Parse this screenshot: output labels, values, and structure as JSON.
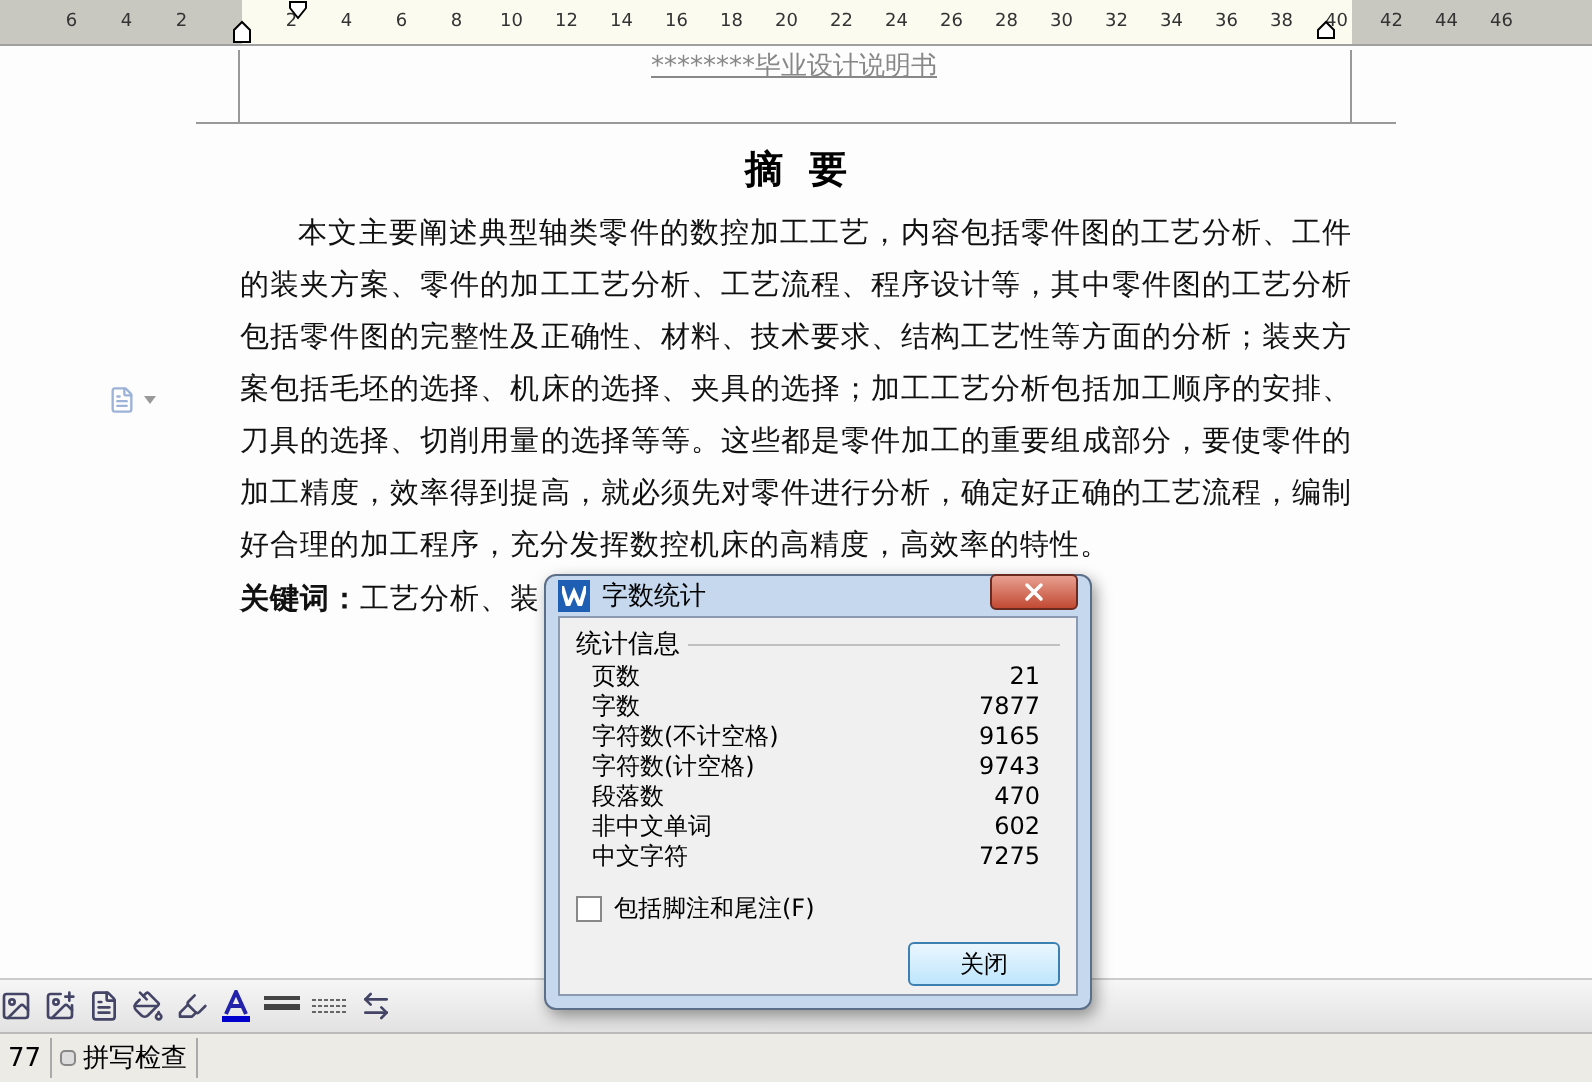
{
  "ruler": {
    "labels": [
      "6",
      "4",
      "2",
      "2",
      "4",
      "6",
      "8",
      "10",
      "12",
      "14",
      "16",
      "18",
      "20",
      "22",
      "24",
      "26",
      "28",
      "30",
      "32",
      "34",
      "36",
      "38",
      "40",
      "42",
      "44",
      "46"
    ]
  },
  "document": {
    "header": "********毕业设计说明书",
    "title": "摘  要",
    "body": "本文主要阐述典型轴类零件的数控加工工艺，内容包括零件图的工艺分析、工件的装夹方案、零件的加工工艺分析、工艺流程、程序设计等，其中零件图的工艺分析包括零件图的完整性及正确性、材料、技术要求、结构工艺性等方面的分析；装夹方案包括毛坯的选择、机床的选择、夹具的选择；加工工艺分析包括加工顺序的安排、刀具的选择、切削用量的选择等等。这些都是零件加工的重要组成部分，要使零件的加工精度，效率得到提高，就必须先对零件进行分析，确定好正确的工艺流程，编制好合理的加工程序，充分发挥数控机床的高精度，高效率的特性。",
    "keywords_label": "关键词：",
    "keywords": "工艺分析、装"
  },
  "dialog": {
    "title": "字数统计",
    "group": "统计信息",
    "rows": [
      {
        "label": "页数",
        "value": "21"
      },
      {
        "label": "字数",
        "value": "7877"
      },
      {
        "label": "字符数(不计空格)",
        "value": "9165"
      },
      {
        "label": "字符数(计空格)",
        "value": "9743"
      },
      {
        "label": "段落数",
        "value": "470"
      },
      {
        "label": "非中文单词",
        "value": "602"
      },
      {
        "label": "中文字符",
        "value": "7275"
      }
    ],
    "checkbox": {
      "label": "包括脚注和尾注(F)",
      "checked": false
    },
    "button": "关闭"
  },
  "status_bar": {
    "page_fragment": "77",
    "spell_check": "拼写检查"
  }
}
